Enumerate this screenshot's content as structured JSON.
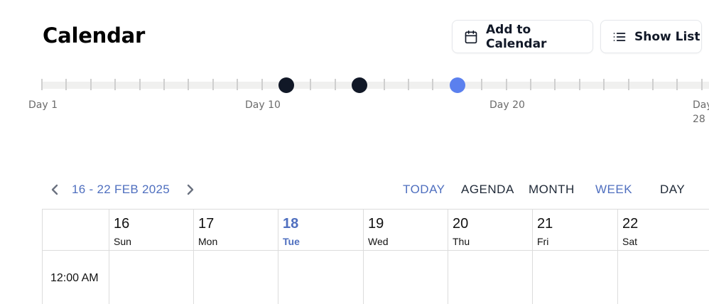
{
  "header": {
    "title": "Calendar",
    "add_button": "Add to Calendar",
    "list_button": "Show List"
  },
  "timeline": {
    "labels": [
      "Day 1",
      "Day 10",
      "Day 20",
      "Day",
      "28"
    ],
    "markers": [
      {
        "day": 11,
        "color": "#111827"
      },
      {
        "day": 14,
        "color": "#111827"
      },
      {
        "day": 18,
        "color": "#5b80ee"
      }
    ]
  },
  "calendar": {
    "range": "16 - 22 FEB 2025",
    "views": [
      "TODAY",
      "AGENDA",
      "MONTH",
      "WEEK",
      "DAY"
    ],
    "active_view": "WEEK",
    "days": [
      {
        "num": "16",
        "name": "Sun"
      },
      {
        "num": "17",
        "name": "Mon"
      },
      {
        "num": "18",
        "name": "Tue"
      },
      {
        "num": "19",
        "name": "Wed"
      },
      {
        "num": "20",
        "name": "Thu"
      },
      {
        "num": "21",
        "name": "Fri"
      },
      {
        "num": "22",
        "name": "Sat"
      }
    ],
    "today_index": 2,
    "time_rows": [
      "12:00 AM"
    ]
  },
  "colors": {
    "accent": "#4f6fbf",
    "marker_active": "#5b80ee",
    "marker": "#111827"
  }
}
